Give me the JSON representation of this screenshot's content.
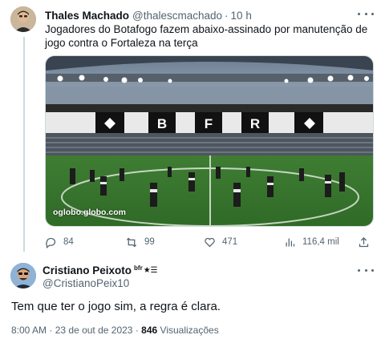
{
  "colors": {
    "text": "#0f1419",
    "secondary": "#536471",
    "border": "#cfd9de"
  },
  "tweet1": {
    "name": "Thales Machado",
    "handle": "@thalescmachado",
    "separator": "·",
    "time": "10 h",
    "text": "Jogadores do Botafogo fazem abaixo-assinado por manutenção de jogo contra o Fortaleza na terça",
    "media": {
      "alt_icon_names": [
        "stadium-photo"
      ],
      "stand_letters": [
        "B",
        "F",
        "R"
      ],
      "watermark": "oglobo.globo.com"
    },
    "actions": {
      "replies": "84",
      "retweets": "99",
      "likes": "471",
      "views": "116,4 mil"
    }
  },
  "tweet2": {
    "name": "Cristiano Peixoto",
    "badge": "bfr",
    "stars": "★☰",
    "handle": "@CristianoPeix10",
    "text": "Tem que ter o jogo sim, a regra é clara.",
    "time": "8:00 AM",
    "separator": "·",
    "date": "23 de out de 2023",
    "views_count": "846",
    "views_label": "Visualizações"
  }
}
